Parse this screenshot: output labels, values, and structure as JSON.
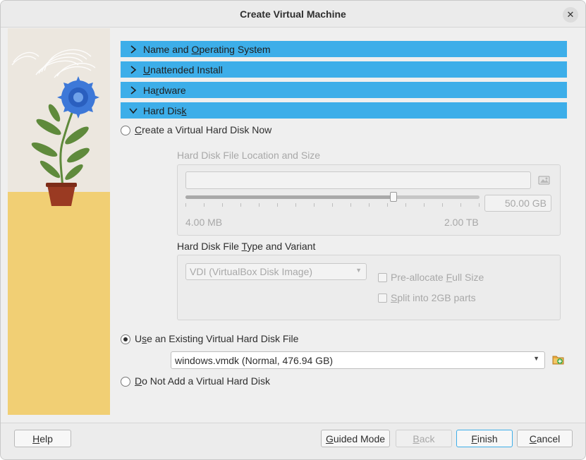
{
  "window": {
    "title": "Create Virtual Machine"
  },
  "sections": [
    {
      "label_pre": "Name and ",
      "label_key": "O",
      "label_post": "perating System",
      "expanded": false
    },
    {
      "label_pre": "",
      "label_key": "U",
      "label_post": "nattended Install",
      "expanded": false
    },
    {
      "label_pre": "Ha",
      "label_key": "r",
      "label_post": "dware",
      "expanded": false
    },
    {
      "label_pre": "Hard Dis",
      "label_key": "k",
      "label_post": "",
      "expanded": true
    }
  ],
  "hard_disk": {
    "create_option": {
      "pre": "",
      "key": "C",
      "post": "reate a Virtual Hard Disk Now",
      "selected": false
    },
    "location_group": {
      "title": "Hard Disk File Location and Size",
      "path_value": "",
      "size_value": "50.00 GB",
      "slider_min_label": "4.00 MB",
      "slider_max_label": "2.00 TB",
      "slider_fraction": 0.69
    },
    "type_group": {
      "title_pre": "Hard Disk File ",
      "title_key": "T",
      "title_post": "ype and Variant",
      "type_value": "VDI (VirtualBox Disk Image)",
      "preallocate_pre": "Pre-allocate ",
      "preallocate_key": "F",
      "preallocate_post": "ull Size",
      "split_pre": "",
      "split_key": "S",
      "split_post": "plit into 2GB parts",
      "preallocate_checked": false,
      "split_checked": false
    },
    "existing_option": {
      "pre": "U",
      "key": "s",
      "post": "e an Existing Virtual Hard Disk File",
      "selected": true
    },
    "existing_value": "windows.vmdk (Normal, 476.94 GB)",
    "none_option": {
      "pre": "",
      "key": "D",
      "post": "o Not Add a Virtual Hard Disk",
      "selected": false
    }
  },
  "footer": {
    "help": {
      "pre": "",
      "key": "H",
      "post": "elp"
    },
    "guided": {
      "pre": "",
      "key": "G",
      "post": "uided Mode"
    },
    "back": {
      "pre": "",
      "key": "B",
      "post": "ack"
    },
    "finish": {
      "pre": "",
      "key": "F",
      "post": "inish"
    },
    "cancel": {
      "pre": "",
      "key": "C",
      "post": "ancel"
    }
  },
  "colors": {
    "accent": "#3daee9",
    "window_bg": "#efefef",
    "floor": "#f1cf74",
    "flower": "#3d78d8",
    "leaf": "#5f8a3c",
    "pot": "#9a3a22"
  },
  "icons": [
    "close-icon",
    "chevron-right-icon",
    "chevron-down-icon",
    "folder-open-icon",
    "folder-add-icon",
    "dropdown-arrow-icon"
  ]
}
